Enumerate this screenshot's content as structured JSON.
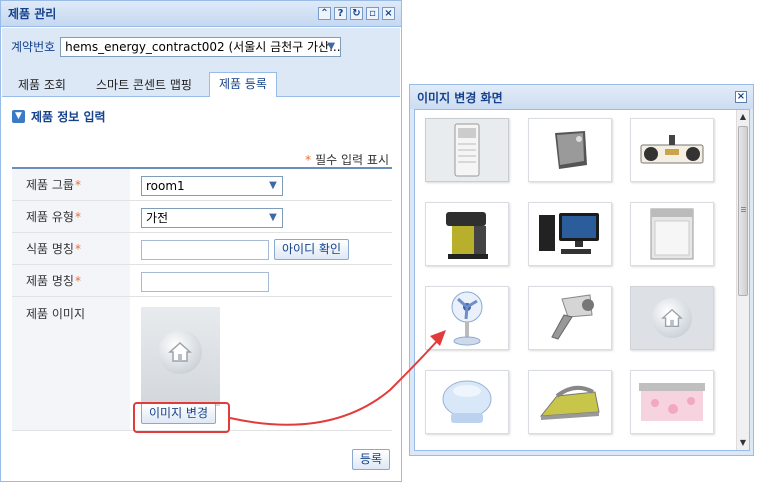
{
  "left_panel": {
    "title": "제품 관리",
    "tool_icons": [
      "collapse-icon",
      "help-icon",
      "refresh-icon",
      "maximize-icon",
      "close-icon"
    ],
    "contract": {
      "label": "계약번호",
      "value": "hems_energy_contract002 (서울시 금천구 가산..."
    },
    "tabs": [
      "제품 조회",
      "스마트 콘센트 맵핑",
      "제품 등록"
    ],
    "active_tab": "제품 등록",
    "section_title": "제품 정보 입력",
    "required_note": "필수 입력 표시",
    "form": {
      "group_label": "제품 그룹",
      "group_value": "room1",
      "type_label": "제품 유형",
      "type_value": "가전",
      "id_label": "식품 명칭",
      "id_check_button": "아이디 확인",
      "name_label": "제품 명칭",
      "image_label": "제품 이미지",
      "change_image_button": "이미지 변경"
    },
    "submit_button": "등록"
  },
  "right_panel": {
    "title": "이미지 변경 화면",
    "images": [
      "air-conditioner",
      "air-purifier",
      "audio-system",
      "coffee-machine",
      "desktop-computer",
      "dishwasher",
      "electric-fan",
      "hair-dryer",
      "default-home-image",
      "humidifier",
      "steam-iron",
      "printer"
    ],
    "selected_index": 0
  },
  "colors": {
    "panel_border": "#99bbe8",
    "title_text": "#15428b",
    "required_star": "#e8702a",
    "highlight_red": "#e23b3b"
  }
}
